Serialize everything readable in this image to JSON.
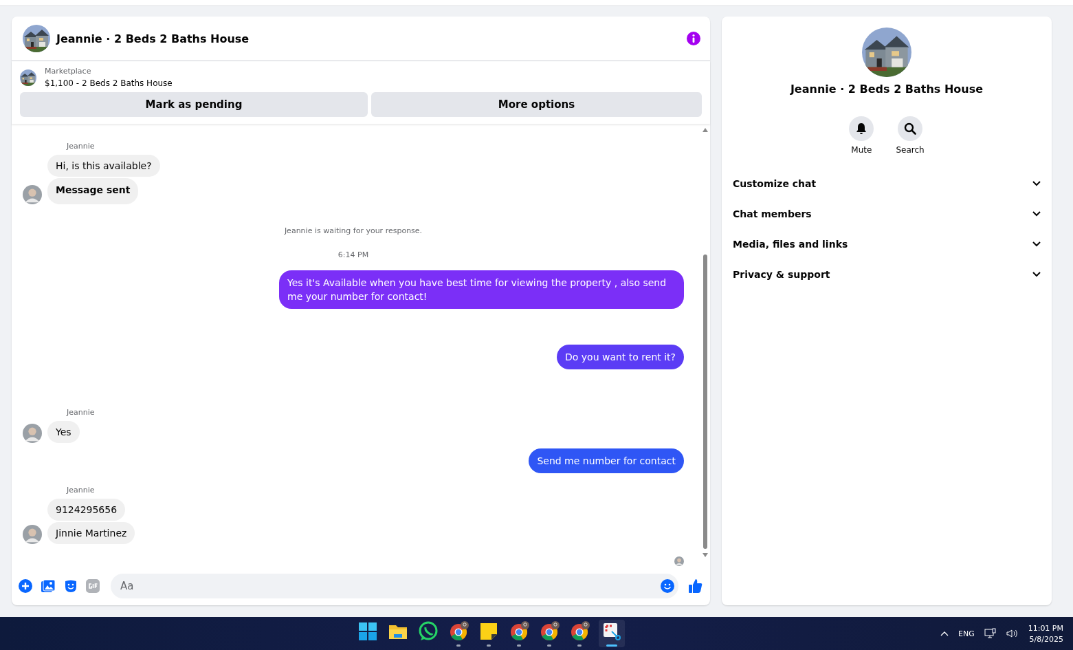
{
  "conversation": {
    "title": "Jeannie · 2 Beds 2 Baths House"
  },
  "listing": {
    "source": "Marketplace",
    "title": "$1,100 - 2 Beds 2 Baths House"
  },
  "actions": [
    "Mark as pending",
    "More options"
  ],
  "messages": [
    {
      "kind": "incoming",
      "sender": "Jeannie",
      "bubbles": [
        {
          "text": "Hi, is this available?",
          "bold": false
        },
        {
          "text": "Message sent",
          "bold": true
        }
      ]
    },
    {
      "kind": "status",
      "text": "Jeannie is waiting for your response."
    },
    {
      "kind": "time",
      "text": "6:14 PM"
    },
    {
      "kind": "outgoing",
      "text": "Yes it's Available when you have best time for viewing the property , also send me your number for contact!",
      "color": "#7b2ff7"
    },
    {
      "kind": "outgoing",
      "text": "Do you want to rent it?",
      "color": "#5b3cf5"
    },
    {
      "kind": "incoming",
      "sender": "Jeannie",
      "bubbles": [
        {
          "text": "Yes",
          "bold": false
        }
      ]
    },
    {
      "kind": "outgoing",
      "text": "Send me number for contact",
      "color": "#2f56f5"
    },
    {
      "kind": "incoming",
      "sender": "Jeannie",
      "bubbles": [
        {
          "text": "9124295656",
          "bold": false
        },
        {
          "text": "Jinnie Martinez",
          "bold": false
        }
      ]
    },
    {
      "kind": "seen"
    }
  ],
  "composer": {
    "placeholder": "Aa"
  },
  "profile": {
    "title": "Jeannie · 2 Beds 2 Baths House",
    "buttons": [
      {
        "kind": "mute",
        "label": "Mute"
      },
      {
        "kind": "search",
        "label": "Search"
      }
    ],
    "sections": [
      {
        "label": "Customize chat",
        "expanded": false
      },
      {
        "label": "Chat members",
        "expanded": false
      },
      {
        "label": "Media, files and links",
        "expanded": false
      },
      {
        "label": "Privacy & support",
        "expanded": false
      }
    ]
  },
  "taskbar": {
    "apps": [
      {
        "kind": "start",
        "active": false
      },
      {
        "kind": "folder",
        "active": false
      },
      {
        "kind": "whatsapp",
        "active": false
      },
      {
        "kind": "chrome",
        "active": true
      },
      {
        "kind": "notes",
        "active": true
      },
      {
        "kind": "chrome",
        "active": true
      },
      {
        "kind": "chrome",
        "active": true
      },
      {
        "kind": "chrome",
        "active": true
      },
      {
        "kind": "snip",
        "active": true
      }
    ],
    "language": "ENG",
    "time": "11:01 PM",
    "date": "5/8/2025"
  }
}
